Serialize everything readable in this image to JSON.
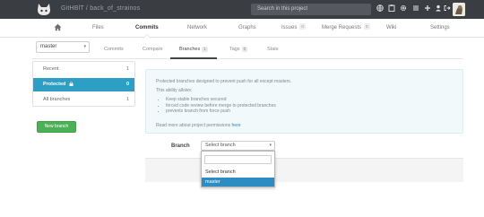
{
  "header": {
    "project_title": "GitHBlT / back_of_strainos",
    "search_placeholder": "Search in this project",
    "icons": [
      "globe-icon",
      "clipboard-icon",
      "gear-icon",
      "tasks-icon",
      "plus-icon",
      "user-icon",
      "signout-icon"
    ]
  },
  "main_nav": {
    "items": [
      {
        "label": "Files"
      },
      {
        "label": "Commits"
      },
      {
        "label": "Network"
      },
      {
        "label": "Graphs"
      },
      {
        "label": "Issues",
        "badge": "0"
      },
      {
        "label": "Merge Requests",
        "badge": "0"
      },
      {
        "label": "Wiki"
      },
      {
        "label": "Settings"
      }
    ],
    "active": "Commits"
  },
  "sub_nav": {
    "ref_value": "master",
    "tabs": [
      {
        "label": "Commits"
      },
      {
        "label": "Compare"
      },
      {
        "label": "Branches",
        "badge": "1"
      },
      {
        "label": "Tags",
        "badge": "0"
      },
      {
        "label": "Stats"
      }
    ],
    "active": "Branches"
  },
  "branch_panel": {
    "rows": [
      {
        "label": "Recent",
        "count": "1"
      },
      {
        "label": "Protected",
        "count": "0"
      },
      {
        "label": "All branches",
        "count": "1"
      }
    ],
    "active": "Protected"
  },
  "new_branch_label": "New branch",
  "info": {
    "line1": "Protected branches designed to prevent push for all except masters.",
    "line2": "This ability allows:",
    "bullets": [
      "Keep stable branches secured",
      "forced code review before merge to protected branches",
      "prevents branch from force push"
    ],
    "footer_text": "Read more about project permissions ",
    "footer_link": "here"
  },
  "form": {
    "branch_label": "Branch",
    "select_value": "Select branch"
  },
  "dropdown": {
    "options": [
      "Select branch",
      "master"
    ],
    "selected": "master"
  },
  "colors": {
    "header_bg": "#3a3d42",
    "active_blue": "#2e9fc4",
    "green": "#4cb156",
    "info_bg": "#f2f9fb"
  }
}
